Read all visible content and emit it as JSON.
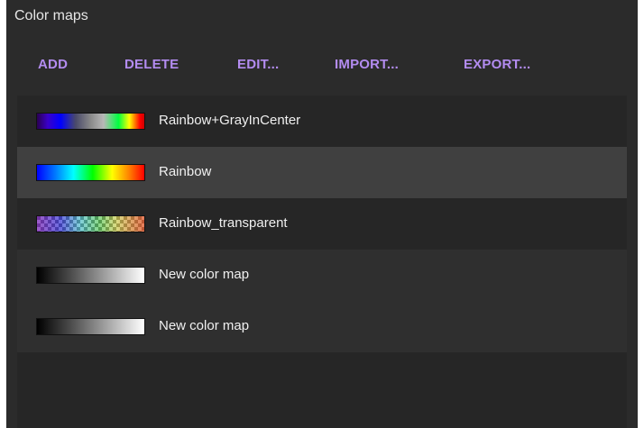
{
  "panel": {
    "title": "Color maps"
  },
  "toolbar": {
    "add_label": "ADD",
    "delete_label": "DELETE",
    "edit_label": "EDIT...",
    "import_label": "IMPORT...",
    "export_label": "EXPORT..."
  },
  "colors": {
    "panel_background": "#2b2b2b",
    "list_background": "#262626",
    "selected_row": "#404040",
    "accent": "#b38cf0",
    "text": "#f0f0f0"
  },
  "color_maps": [
    {
      "name": "Rainbow+GrayInCenter",
      "selected": false
    },
    {
      "name": "Rainbow",
      "selected": true
    },
    {
      "name": "Rainbow_transparent",
      "selected": false
    },
    {
      "name": "New color map",
      "selected": false
    },
    {
      "name": "New color map",
      "selected": false
    }
  ]
}
